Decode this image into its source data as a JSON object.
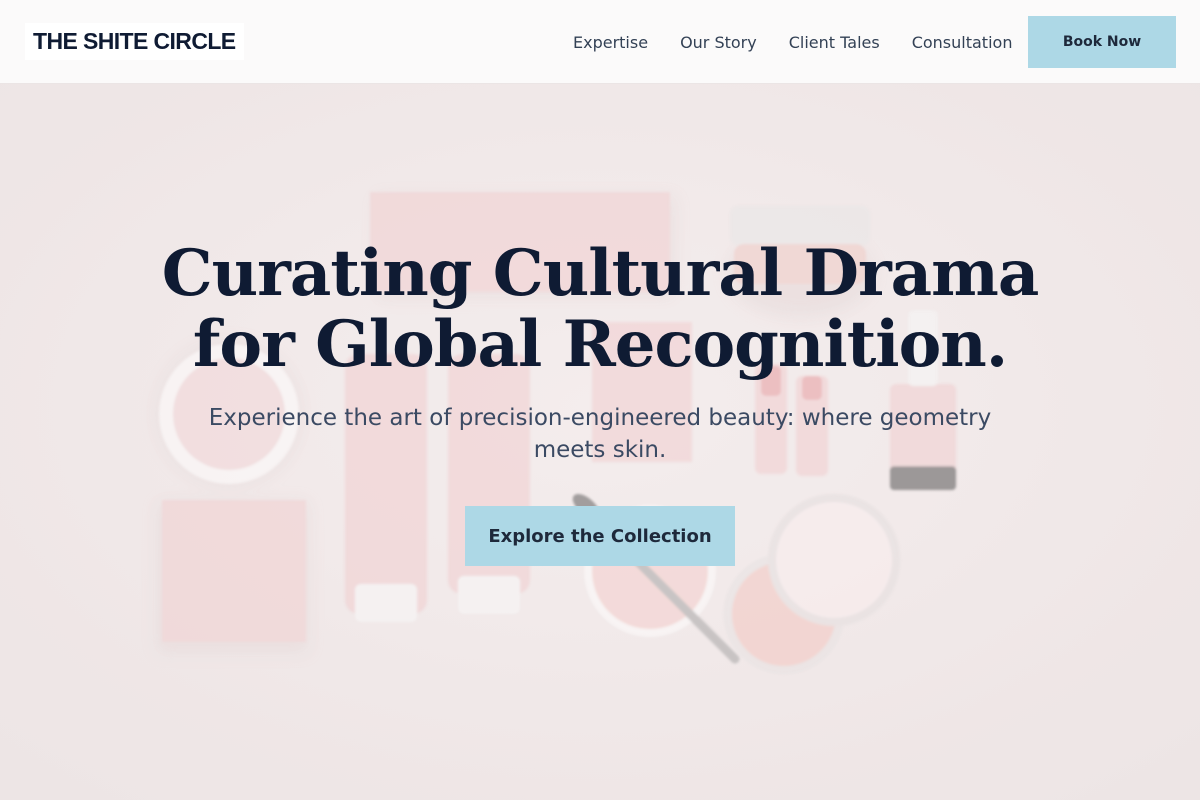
{
  "brand": {
    "name": "THE SHITE CIRCLE"
  },
  "nav": {
    "links": [
      "Expertise",
      "Our Story",
      "Client Tales",
      "Consultation"
    ],
    "cta_label": "Book Now"
  },
  "hero": {
    "title_line1": "Curating Cultural Drama",
    "title_line2": "for Global Recognition.",
    "subtitle": "Experience the art of precision-engineered beauty: where geometry meets skin.",
    "cta_label": "Explore the Collection",
    "background": "cosmetic-products-flatlay-image"
  },
  "colors": {
    "accent": "#add8e6",
    "heading": "#0f1b33",
    "nav_bg": "#fbfafa",
    "hero_bg": "#f1eaea",
    "product_pink": "#f0c9cb"
  }
}
